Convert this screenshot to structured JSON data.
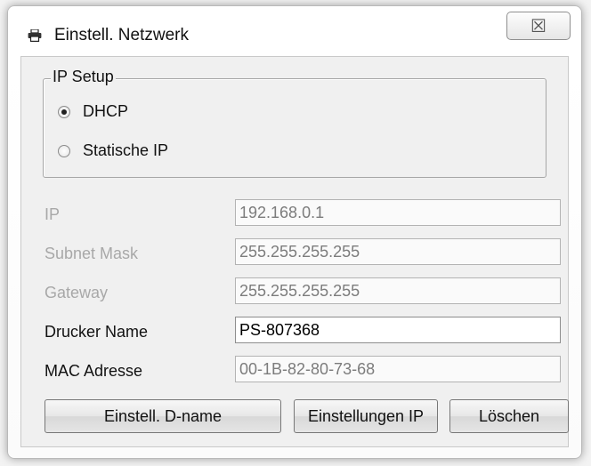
{
  "window": {
    "title": "Einstell. Netzwerk",
    "icon": "printer-icon",
    "close_glyph": "☒",
    "close_icon": "close-icon"
  },
  "ip_setup": {
    "legend": "IP Setup",
    "options": [
      {
        "label": "DHCP",
        "checked": true
      },
      {
        "label": "Statische IP",
        "checked": false
      }
    ]
  },
  "fields": {
    "ip": {
      "label": "IP",
      "value": "192.168.0.1",
      "enabled": false
    },
    "subnet": {
      "label": "Subnet Mask",
      "value": "255.255.255.255",
      "enabled": false
    },
    "gateway": {
      "label": "Gateway",
      "value": "255.255.255.255",
      "enabled": false
    },
    "printer_name": {
      "label": "Drucker Name",
      "value": "PS-807368",
      "enabled": true
    },
    "mac": {
      "label": "MAC Adresse",
      "value": "00-1B-82-80-73-68",
      "enabled": false
    }
  },
  "buttons": {
    "set_dname": "Einstell. D-name",
    "set_ip": "Einstellungen IP",
    "delete": "Löschen"
  }
}
